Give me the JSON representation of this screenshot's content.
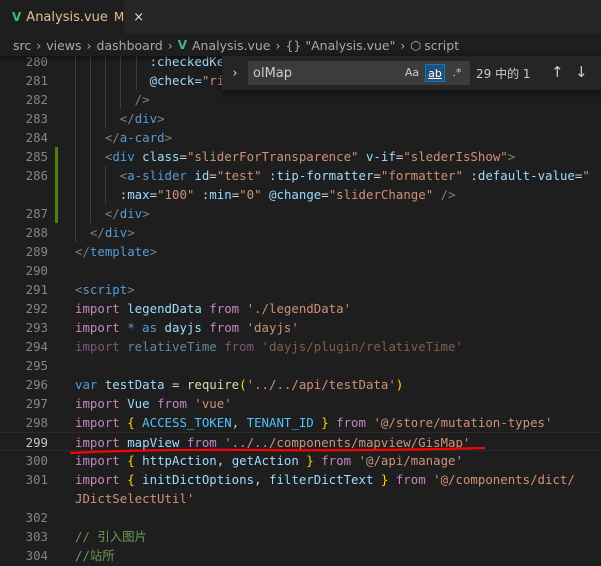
{
  "tab": {
    "file": "Analysis.vue",
    "status": "M",
    "close": "×"
  },
  "breadcrumb": [
    "src",
    "views",
    "dashboard",
    "Analysis.vue",
    "{} \"Analysis.vue\"",
    "script"
  ],
  "find": {
    "query": "olMap",
    "case_label": "Aa",
    "word_label": "ab",
    "regex_label": ".*",
    "count": "29 中的 1",
    "prev": "↑",
    "next": "↓"
  },
  "current_line": "299",
  "lines": [
    {
      "n": "280",
      "t": [
        [
          "          :checkedKe",
          "at"
        ]
      ]
    },
    {
      "n": "281",
      "t": [
        [
          "          @check=",
          "at"
        ],
        [
          "\"ri",
          "s"
        ]
      ]
    },
    {
      "n": "282",
      "t": [
        [
          "        />",
          "p"
        ]
      ]
    },
    {
      "n": "283",
      "t": [
        [
          "      </",
          "p"
        ],
        [
          "div",
          "tg"
        ],
        [
          ">",
          "p"
        ]
      ]
    },
    {
      "n": "284",
      "t": [
        [
          "    </",
          "p"
        ],
        [
          "a-card",
          "tg"
        ],
        [
          ">",
          "p"
        ]
      ]
    },
    {
      "n": "285",
      "t": [
        [
          "    <",
          "p"
        ],
        [
          "div",
          "tg"
        ],
        [
          " class",
          "at"
        ],
        [
          "=",
          "op"
        ],
        [
          "\"sliderForTransparence\"",
          "s"
        ],
        [
          " v-if",
          "at"
        ],
        [
          "=",
          "op"
        ],
        [
          "\"slederIsShow\"",
          "s"
        ],
        [
          ">",
          "p"
        ]
      ]
    },
    {
      "n": "286",
      "t": [
        [
          "      <",
          "p"
        ],
        [
          "a-slider",
          "tg"
        ],
        [
          " id",
          "at"
        ],
        [
          "=",
          "op"
        ],
        [
          "\"test\"",
          "s"
        ],
        [
          " :tip-formatter",
          "at"
        ],
        [
          "=",
          "op"
        ],
        [
          "\"formatter\"",
          "s"
        ],
        [
          " :default-value",
          "at"
        ],
        [
          "=",
          "op"
        ],
        [
          "\"",
          "s"
        ]
      ]
    },
    {
      "n": "",
      "t": [
        [
          "      :max",
          "at"
        ],
        [
          "=",
          "op"
        ],
        [
          "\"100\"",
          "s"
        ],
        [
          " :min",
          "at"
        ],
        [
          "=",
          "op"
        ],
        [
          "\"0\"",
          "s"
        ],
        [
          " @change",
          "at"
        ],
        [
          "=",
          "op"
        ],
        [
          "\"sliderChange\"",
          "s"
        ],
        [
          " />",
          "p"
        ]
      ]
    },
    {
      "n": "287",
      "t": [
        [
          "    </",
          "p"
        ],
        [
          "div",
          "tg"
        ],
        [
          ">",
          "p"
        ]
      ]
    },
    {
      "n": "288",
      "t": [
        [
          "  </",
          "p"
        ],
        [
          "div",
          "tg"
        ],
        [
          ">",
          "p"
        ]
      ]
    },
    {
      "n": "289",
      "t": [
        [
          "</",
          "p"
        ],
        [
          "template",
          "tg"
        ],
        [
          ">",
          "p"
        ]
      ]
    },
    {
      "n": "290",
      "t": []
    },
    {
      "n": "291",
      "t": [
        [
          "<",
          "p"
        ],
        [
          "script",
          "tg"
        ],
        [
          ">",
          "p"
        ]
      ]
    },
    {
      "n": "292",
      "t": [
        [
          "import",
          "kw"
        ],
        [
          " legendData ",
          "v"
        ],
        [
          "from",
          "kw"
        ],
        [
          " './legendData'",
          "s"
        ]
      ]
    },
    {
      "n": "293",
      "t": [
        [
          "import",
          "kw"
        ],
        [
          " * ",
          "kv"
        ],
        [
          "as",
          "kv"
        ],
        [
          " dayjs ",
          "v"
        ],
        [
          "from",
          "kw"
        ],
        [
          " 'dayjs'",
          "s"
        ]
      ]
    },
    {
      "n": "294",
      "dim": true,
      "t": [
        [
          "import",
          "kw"
        ],
        [
          " relativeTime ",
          "v"
        ],
        [
          "from",
          "kw"
        ],
        [
          " 'dayjs/plugin/relativeTime'",
          "s"
        ]
      ]
    },
    {
      "n": "295",
      "t": []
    },
    {
      "n": "296",
      "t": [
        [
          "var",
          "kv"
        ],
        [
          " testData ",
          "v"
        ],
        [
          "= ",
          "op"
        ],
        [
          "require",
          "fn"
        ],
        [
          "(",
          "br"
        ],
        [
          "'../../api/testData'",
          "s"
        ],
        [
          ")",
          "br"
        ]
      ]
    },
    {
      "n": "297",
      "t": [
        [
          "import",
          "kw"
        ],
        [
          " Vue ",
          "v"
        ],
        [
          "from",
          "kw"
        ],
        [
          " 'vue'",
          "s"
        ]
      ]
    },
    {
      "n": "298",
      "t": [
        [
          "import",
          "kw"
        ],
        [
          " { ",
          "br"
        ],
        [
          "ACCESS_TOKEN",
          "c"
        ],
        [
          ", ",
          "op"
        ],
        [
          "TENANT_ID",
          "c"
        ],
        [
          " } ",
          "br"
        ],
        [
          "from",
          "kw"
        ],
        [
          " '@/store/mutation-types'",
          "s"
        ]
      ]
    },
    {
      "n": "299",
      "t": [
        [
          "import",
          "kw"
        ],
        [
          " mapView ",
          "v"
        ],
        [
          "from",
          "kw"
        ],
        [
          " '../../components/mapview/GisMap'",
          "s"
        ]
      ]
    },
    {
      "n": "300",
      "t": [
        [
          "import",
          "kw"
        ],
        [
          " { ",
          "br"
        ],
        [
          "httpAction",
          "v"
        ],
        [
          ", ",
          "op"
        ],
        [
          "getAction",
          "v"
        ],
        [
          " } ",
          "br"
        ],
        [
          "from",
          "kw"
        ],
        [
          " '@/api/manage'",
          "s"
        ]
      ]
    },
    {
      "n": "301",
      "t": [
        [
          "import",
          "kw"
        ],
        [
          " { ",
          "br"
        ],
        [
          "initDictOptions",
          "v"
        ],
        [
          ", ",
          "op"
        ],
        [
          "filterDictText",
          "v"
        ],
        [
          " } ",
          "br"
        ],
        [
          "from",
          "kw"
        ],
        [
          " '@/components/dict/",
          "s"
        ]
      ]
    },
    {
      "n": "",
      "t": [
        [
          "JDictSelectUtil'",
          "s"
        ]
      ]
    },
    {
      "n": "302",
      "t": []
    },
    {
      "n": "303",
      "t": [
        [
          "// 引入图片",
          "cm"
        ]
      ]
    },
    {
      "n": "304",
      "t": [
        [
          "//站所",
          "cm"
        ]
      ]
    }
  ],
  "colors": {
    "annotation": "#ff0000",
    "modified": "#587c0c"
  }
}
